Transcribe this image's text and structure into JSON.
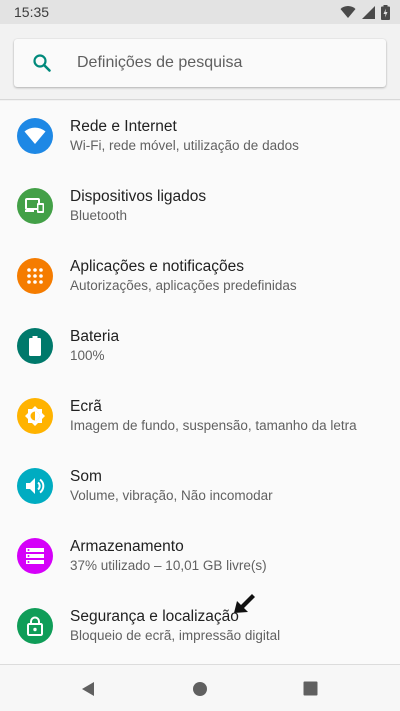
{
  "status_bar": {
    "time": "15:35",
    "icons": [
      "wifi-icon",
      "cell-signal-icon",
      "battery-charging-icon"
    ]
  },
  "search": {
    "placeholder": "Definições de pesquisa",
    "icon": "search-icon",
    "accent_color": "#00897b"
  },
  "settings": [
    {
      "title": "Rede e Internet",
      "subtitle": "Wi-Fi, rede móvel, utilização de dados",
      "icon": "wifi-icon",
      "color": "#1e88e5"
    },
    {
      "title": "Dispositivos ligados",
      "subtitle": "Bluetooth",
      "icon": "connected-devices-icon",
      "color": "#43a047"
    },
    {
      "title": "Aplicações e notificações",
      "subtitle": "Autorizações, aplicações predefinidas",
      "icon": "apps-grid-icon",
      "color": "#f57c00"
    },
    {
      "title": "Bateria",
      "subtitle": "100%",
      "icon": "battery-icon",
      "color": "#00796b"
    },
    {
      "title": "Ecrã",
      "subtitle": "Imagem de fundo, suspensão, tamanho da letra",
      "icon": "brightness-icon",
      "color": "#ffb300"
    },
    {
      "title": "Som",
      "subtitle": "Volume, vibração, Não incomodar",
      "icon": "volume-icon",
      "color": "#00acc1"
    },
    {
      "title": "Armazenamento",
      "subtitle": "37% utilizado – 10,01 GB livre(s)",
      "icon": "storage-icon",
      "color": "#d500f9"
    },
    {
      "title": "Segurança e localização",
      "subtitle": "Bloqueio de ecrã, impressão digital",
      "icon": "lock-icon",
      "color": "#0f9d58"
    }
  ],
  "nav_bar": {
    "buttons": [
      "back-icon",
      "home-icon",
      "recents-icon"
    ]
  }
}
